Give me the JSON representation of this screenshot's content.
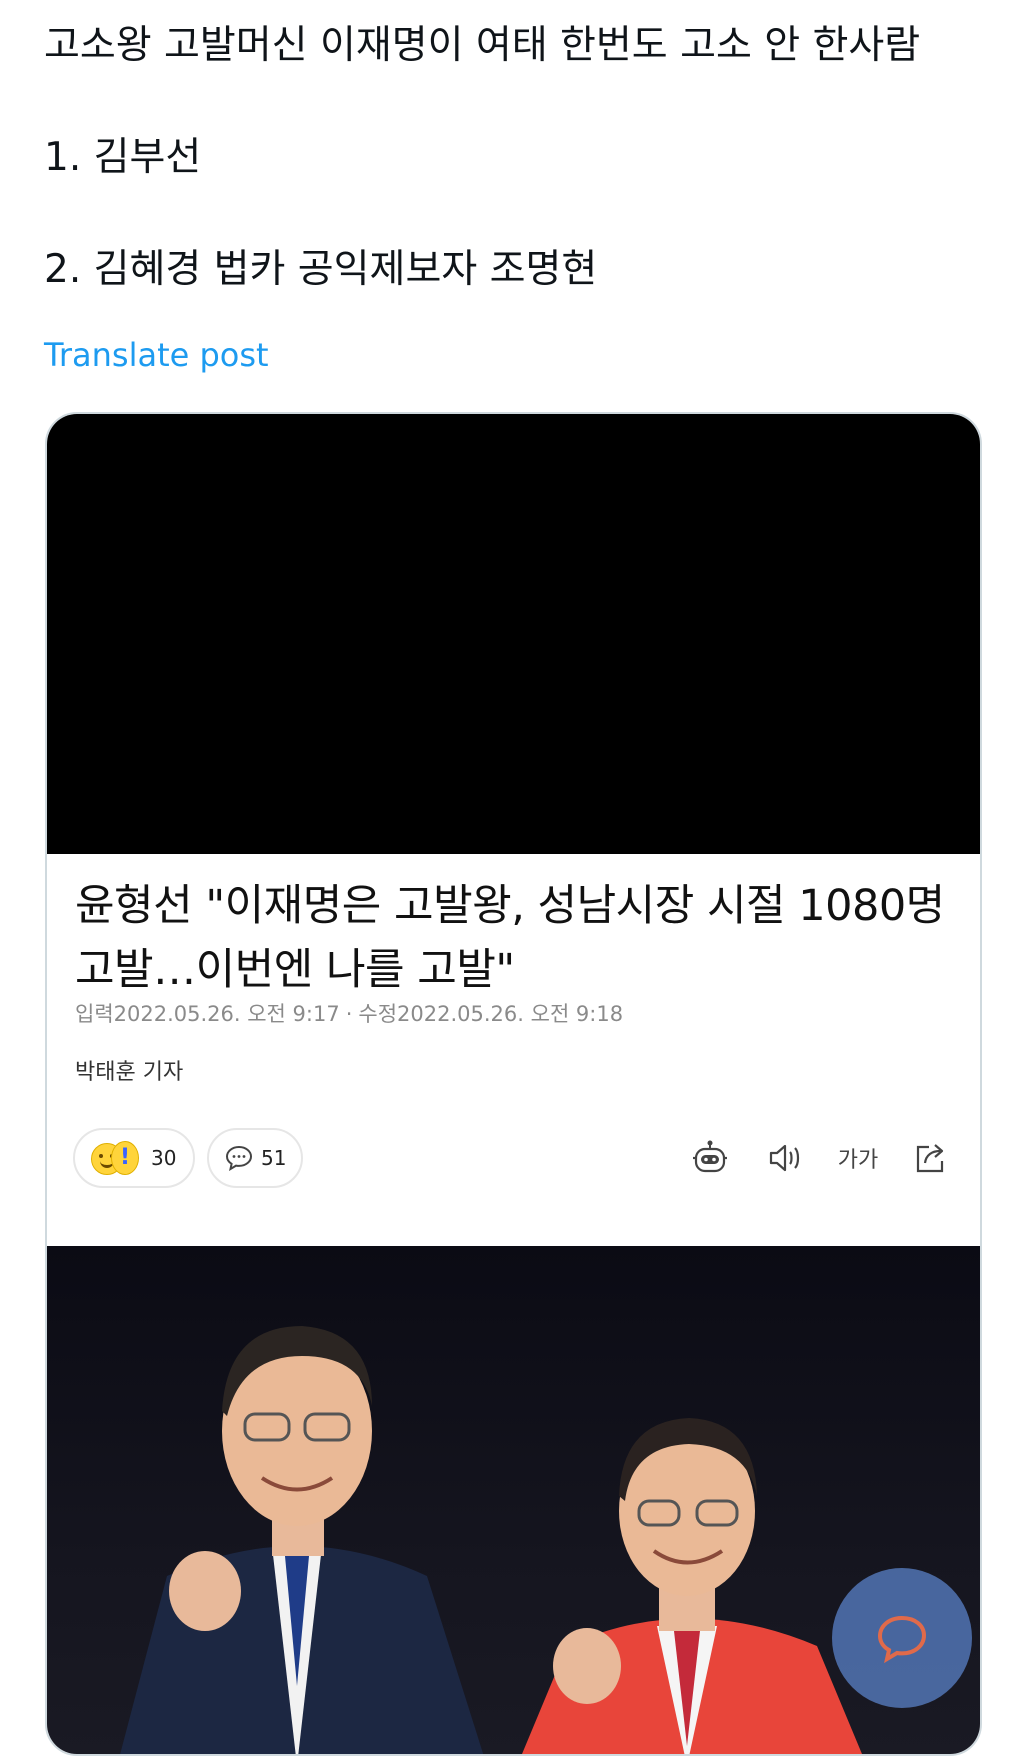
{
  "post": {
    "lines": [
      "고소왕 고발머신 이재명이 여태 한번도 고소 안 한사람",
      "1. 김부선",
      "2. 김혜경 법카 공익제보자 조명현"
    ],
    "translate_label": "Translate post"
  },
  "article": {
    "headline": "윤형선 \"이재명은 고발왕, 성남시장 시절 1080명 고발…이번엔 나를 고발\"",
    "input_label": "입력",
    "input_time": "2022.05.26. 오전 9:17",
    "edit_label": "수정",
    "edit_time": "2022.05.26. 오전 9:18",
    "separator": "·",
    "reporter": "박태훈 기자",
    "reaction_count": "30",
    "comment_count": "51",
    "font_size_label": "가가"
  },
  "colors": {
    "link": "#1d9bf0",
    "text": "#0f1419",
    "border": "#cfd9de"
  },
  "icons": [
    "robot-icon",
    "speaker-icon",
    "font-size-icon",
    "share-icon",
    "comment-bubble-icon",
    "chat-float-icon"
  ]
}
